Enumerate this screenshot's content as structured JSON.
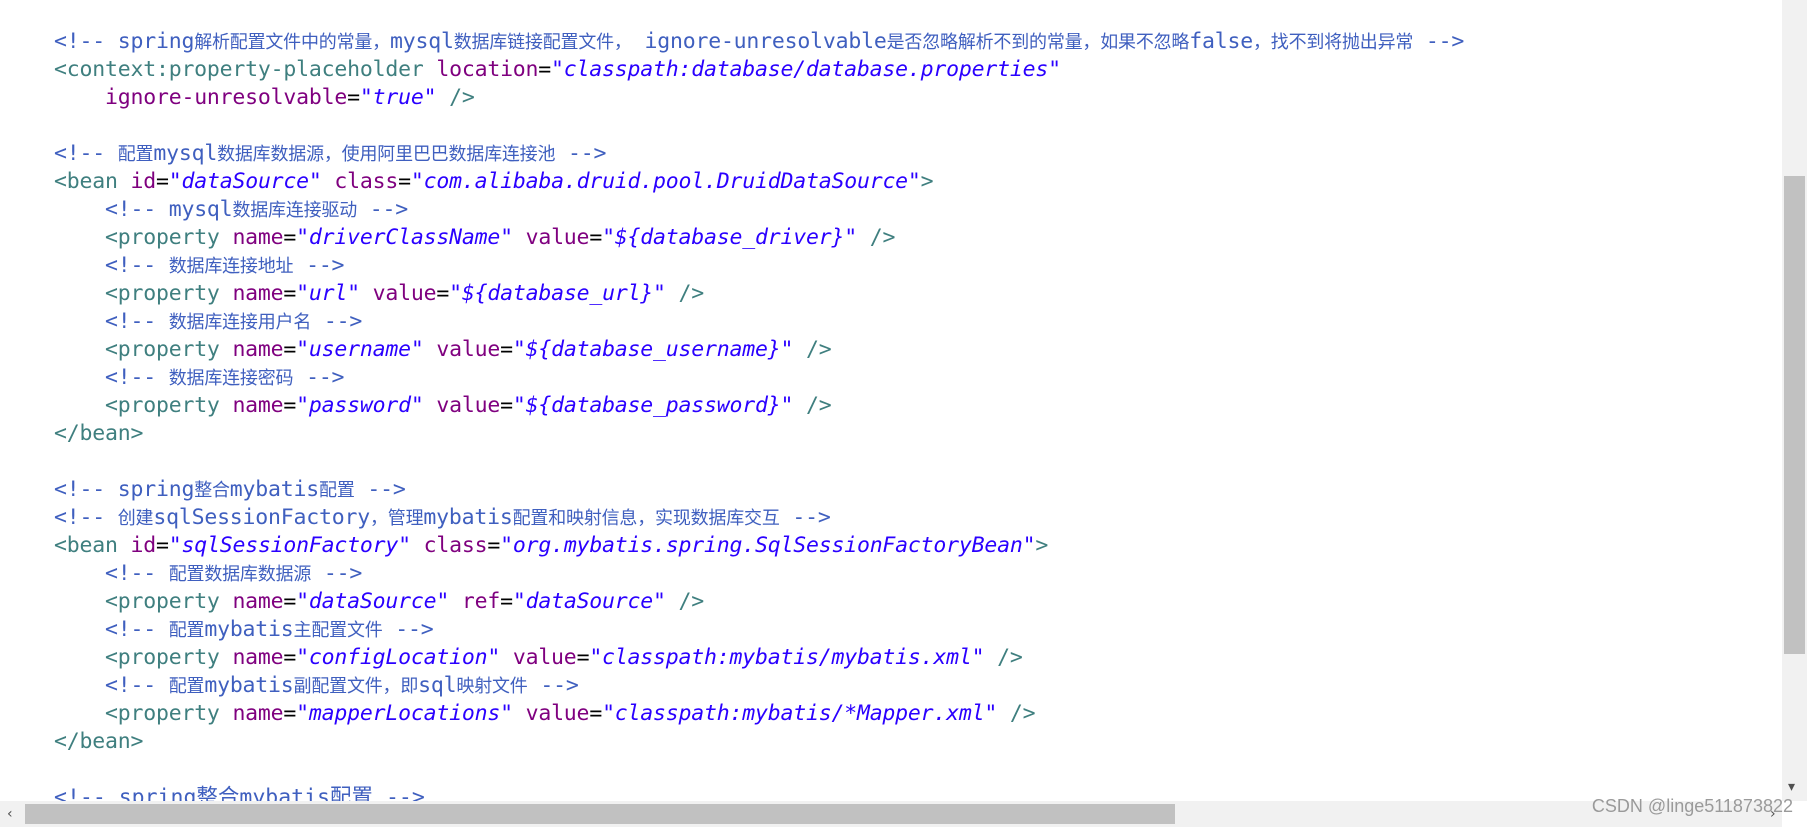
{
  "code_lines": [
    [
      [
        "c",
        "<!-- spring"
      ],
      [
        "cc",
        "解析配置文件中的常量，"
      ],
      [
        "c",
        "mysql"
      ],
      [
        "cc",
        "数据库链接配置文件，"
      ],
      [
        "c",
        " ignore-unresolvable"
      ],
      [
        "cc",
        "是否忽略解析不到的常量，如果不忽略"
      ],
      [
        "c",
        "false"
      ],
      [
        "cc",
        "，找不到将抛出异常"
      ],
      [
        "c",
        " -->"
      ]
    ],
    [
      [
        "t",
        "<context:property-placeholder"
      ],
      [
        "p",
        " "
      ],
      [
        "a",
        "location"
      ],
      [
        "p",
        "="
      ],
      [
        "s",
        "\"classpath:database/database.properties\""
      ]
    ],
    [
      [
        "p",
        "    "
      ],
      [
        "a",
        "ignore-unresolvable"
      ],
      [
        "p",
        "="
      ],
      [
        "s",
        "\"true\""
      ],
      [
        "p",
        " "
      ],
      [
        "t",
        "/>"
      ]
    ],
    [],
    [
      [
        "c",
        "<!-- "
      ],
      [
        "cc",
        "配置"
      ],
      [
        "c",
        "mysql"
      ],
      [
        "cc",
        "数据库数据源，使用阿里巴巴数据库连接池"
      ],
      [
        "c",
        " -->"
      ]
    ],
    [
      [
        "t",
        "<bean"
      ],
      [
        "p",
        " "
      ],
      [
        "a",
        "id"
      ],
      [
        "p",
        "="
      ],
      [
        "s",
        "\"dataSource\""
      ],
      [
        "p",
        " "
      ],
      [
        "a",
        "class"
      ],
      [
        "p",
        "="
      ],
      [
        "s",
        "\"com.alibaba.druid.pool.DruidDataSource\""
      ],
      [
        "t",
        ">"
      ]
    ],
    [
      [
        "p",
        "    "
      ],
      [
        "c",
        "<!-- mysql"
      ],
      [
        "cc",
        "数据库连接驱动"
      ],
      [
        "c",
        " -->"
      ]
    ],
    [
      [
        "p",
        "    "
      ],
      [
        "t",
        "<property"
      ],
      [
        "p",
        " "
      ],
      [
        "a",
        "name"
      ],
      [
        "p",
        "="
      ],
      [
        "s",
        "\"driverClassName\""
      ],
      [
        "p",
        " "
      ],
      [
        "a",
        "value"
      ],
      [
        "p",
        "="
      ],
      [
        "s",
        "\"${database_driver}\""
      ],
      [
        "p",
        " "
      ],
      [
        "t",
        "/>"
      ]
    ],
    [
      [
        "p",
        "    "
      ],
      [
        "c",
        "<!-- "
      ],
      [
        "cc",
        "数据库连接地址"
      ],
      [
        "c",
        " -->"
      ]
    ],
    [
      [
        "p",
        "    "
      ],
      [
        "t",
        "<property"
      ],
      [
        "p",
        " "
      ],
      [
        "a",
        "name"
      ],
      [
        "p",
        "="
      ],
      [
        "s",
        "\"url\""
      ],
      [
        "p",
        " "
      ],
      [
        "a",
        "value"
      ],
      [
        "p",
        "="
      ],
      [
        "s",
        "\"${database_url}\""
      ],
      [
        "p",
        " "
      ],
      [
        "t",
        "/>"
      ]
    ],
    [
      [
        "p",
        "    "
      ],
      [
        "c",
        "<!-- "
      ],
      [
        "cc",
        "数据库连接用户名"
      ],
      [
        "c",
        " -->"
      ]
    ],
    [
      [
        "p",
        "    "
      ],
      [
        "t",
        "<property"
      ],
      [
        "p",
        " "
      ],
      [
        "a",
        "name"
      ],
      [
        "p",
        "="
      ],
      [
        "s",
        "\"username\""
      ],
      [
        "p",
        " "
      ],
      [
        "a",
        "value"
      ],
      [
        "p",
        "="
      ],
      [
        "s",
        "\"${database_username}\""
      ],
      [
        "p",
        " "
      ],
      [
        "t",
        "/>"
      ]
    ],
    [
      [
        "p",
        "    "
      ],
      [
        "c",
        "<!-- "
      ],
      [
        "cc",
        "数据库连接密码"
      ],
      [
        "c",
        " -->"
      ]
    ],
    [
      [
        "p",
        "    "
      ],
      [
        "t",
        "<property"
      ],
      [
        "p",
        " "
      ],
      [
        "a",
        "name"
      ],
      [
        "p",
        "="
      ],
      [
        "s",
        "\"password\""
      ],
      [
        "p",
        " "
      ],
      [
        "a",
        "value"
      ],
      [
        "p",
        "="
      ],
      [
        "s",
        "\"${database_password}\""
      ],
      [
        "p",
        " "
      ],
      [
        "t",
        "/>"
      ]
    ],
    [
      [
        "t",
        "</bean>"
      ]
    ],
    [],
    [
      [
        "c",
        "<!-- spring"
      ],
      [
        "cc",
        "整合"
      ],
      [
        "c",
        "mybatis"
      ],
      [
        "cc",
        "配置"
      ],
      [
        "c",
        " -->"
      ]
    ],
    [
      [
        "c",
        "<!-- "
      ],
      [
        "cc",
        "创建"
      ],
      [
        "c",
        "sqlSessionFactory"
      ],
      [
        "cc",
        "，管理"
      ],
      [
        "c",
        "mybatis"
      ],
      [
        "cc",
        "配置和映射信息，实现数据库交互"
      ],
      [
        "c",
        " -->"
      ]
    ],
    [
      [
        "t",
        "<bean"
      ],
      [
        "p",
        " "
      ],
      [
        "a",
        "id"
      ],
      [
        "p",
        "="
      ],
      [
        "s",
        "\"sqlSessionFactory\""
      ],
      [
        "p",
        " "
      ],
      [
        "a",
        "class"
      ],
      [
        "p",
        "="
      ],
      [
        "s",
        "\"org.mybatis.spring.SqlSessionFactoryBean\""
      ],
      [
        "t",
        ">"
      ]
    ],
    [
      [
        "p",
        "    "
      ],
      [
        "c",
        "<!-- "
      ],
      [
        "cc",
        "配置数据库数据源"
      ],
      [
        "c",
        " -->"
      ]
    ],
    [
      [
        "p",
        "    "
      ],
      [
        "t",
        "<property"
      ],
      [
        "p",
        " "
      ],
      [
        "a",
        "name"
      ],
      [
        "p",
        "="
      ],
      [
        "s",
        "\"dataSource\""
      ],
      [
        "p",
        " "
      ],
      [
        "a",
        "ref"
      ],
      [
        "p",
        "="
      ],
      [
        "s",
        "\"dataSource\""
      ],
      [
        "p",
        " "
      ],
      [
        "t",
        "/>"
      ]
    ],
    [
      [
        "p",
        "    "
      ],
      [
        "c",
        "<!-- "
      ],
      [
        "cc",
        "配置"
      ],
      [
        "c",
        "mybatis"
      ],
      [
        "cc",
        "主配置文件"
      ],
      [
        "c",
        " -->"
      ]
    ],
    [
      [
        "p",
        "    "
      ],
      [
        "t",
        "<property"
      ],
      [
        "p",
        " "
      ],
      [
        "a",
        "name"
      ],
      [
        "p",
        "="
      ],
      [
        "s",
        "\"configLocation\""
      ],
      [
        "p",
        " "
      ],
      [
        "a",
        "value"
      ],
      [
        "p",
        "="
      ],
      [
        "s",
        "\"classpath:mybatis/mybatis.xml\""
      ],
      [
        "p",
        " "
      ],
      [
        "t",
        "/>"
      ]
    ],
    [
      [
        "p",
        "    "
      ],
      [
        "c",
        "<!-- "
      ],
      [
        "cc",
        "配置"
      ],
      [
        "c",
        "mybatis"
      ],
      [
        "cc",
        "副配置文件，即"
      ],
      [
        "c",
        "sql"
      ],
      [
        "cc",
        "映射文件"
      ],
      [
        "c",
        " -->"
      ]
    ],
    [
      [
        "p",
        "    "
      ],
      [
        "t",
        "<property"
      ],
      [
        "p",
        " "
      ],
      [
        "a",
        "name"
      ],
      [
        "p",
        "="
      ],
      [
        "s",
        "\"mapperLocations\""
      ],
      [
        "p",
        " "
      ],
      [
        "a",
        "value"
      ],
      [
        "p",
        "="
      ],
      [
        "s",
        "\"classpath:mybatis/*Mapper.xml\""
      ],
      [
        "p",
        " "
      ],
      [
        "t",
        "/>"
      ]
    ],
    [
      [
        "t",
        "</bean>"
      ]
    ]
  ],
  "partial_line": "<!-- spring整合mybatis配置 -->",
  "watermark": "CSDN @linge511873822",
  "scroll": {
    "vertical_position": 0.24,
    "horizontal_position": 0.0
  },
  "icons": {
    "vscroll_down": "▾",
    "hscroll_left": "‹",
    "hscroll_right": "›"
  }
}
